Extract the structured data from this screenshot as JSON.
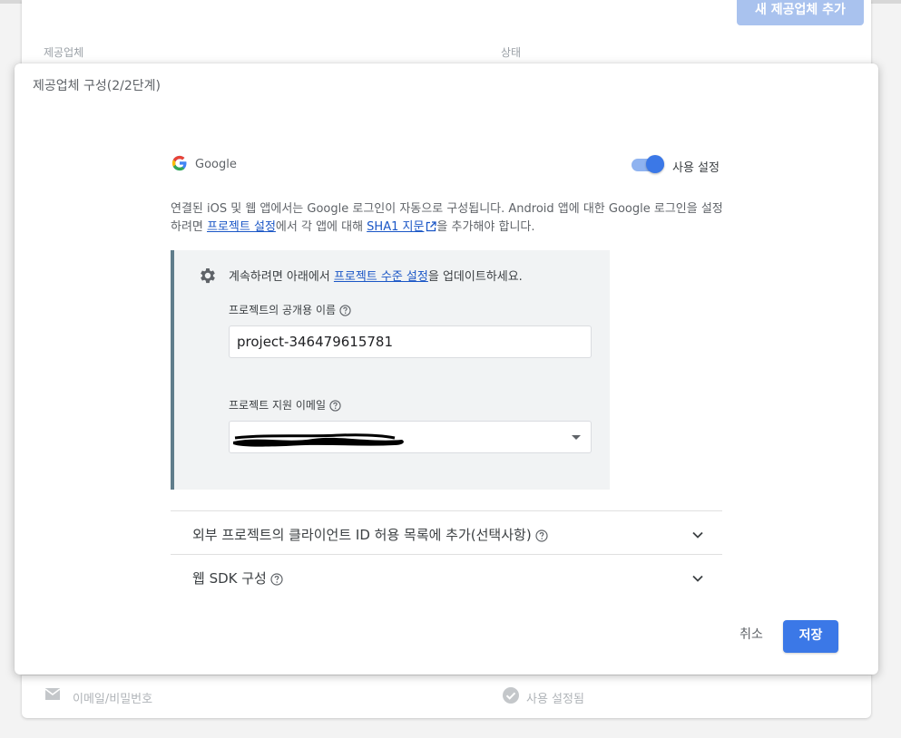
{
  "background": {
    "add_provider_button": "새 제공업체 추가",
    "columns": {
      "provider": "제공업체",
      "status": "상태"
    },
    "row": {
      "icon": "mail-icon",
      "label": "이메일/비밀번호",
      "status_icon": "check-circle-icon",
      "status": "사용 설정됨"
    }
  },
  "dialog": {
    "title": "제공업체 구성(2/2단계)",
    "provider": {
      "name": "Google",
      "icon": "google-logo-icon"
    },
    "enable_toggle": {
      "label": "사용 설정",
      "on": true
    },
    "description": {
      "part1": "연결된 iOS 및 웹 앱에서는 Google 로그인이 자동으로 구성됩니다. Android 앱에 대한 Google 로그인을 설정하려면 ",
      "link1": "프로젝트 설정",
      "part2": "에서 각 앱에 대해 ",
      "link2": "SHA1 지문",
      "part3": "을 추가해야 합니다."
    },
    "settings_panel": {
      "icon": "gear-icon",
      "message_prefix": "계속하려면 아래에서 ",
      "message_link": "프로젝트 수준 설정",
      "message_suffix": "을 업데이트하세요.",
      "public_name_label": "프로젝트의 공개용 이름",
      "public_name_value": "project-346479615781",
      "support_email_label": "프로젝트 지원 이메일",
      "support_email_value": ""
    },
    "accordions": [
      {
        "label": "외부 프로젝트의 클라이언트 ID 허용 목록에 추가(선택사항)"
      },
      {
        "label": "웹 SDK 구성"
      }
    ],
    "cancel_label": "취소",
    "save_label": "저장"
  },
  "colors": {
    "accent": "#3b78e7",
    "toggle_track": "#8fb3f0",
    "link": "#1a56c6",
    "panel_bg": "#f1f3f4",
    "panel_border": "#607d8b"
  }
}
